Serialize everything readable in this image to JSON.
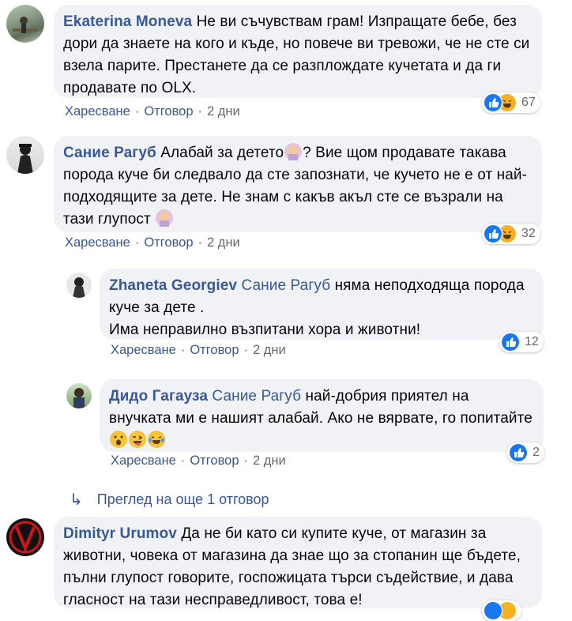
{
  "comments": [
    {
      "author": "Ekaterina Moneva",
      "text": "Не ви съчувствам грам! Изпращате бебе, без дори да знаете на кого и къде, но повече ви тревожи, че не сте си взела парите. Престанете да се разплождате кучетата и да ги продавате по OLX.",
      "like": "Харесване",
      "reply": "Отговор",
      "time": "2 дни",
      "reactions": "67"
    },
    {
      "author": "Сание Рагуб",
      "text_a": "Алабай за детето",
      "text_b": "? Вие щом продавате такава порода куче би следвало да сте запознати, че кучето не е от най-подходящите за дете. Не знам с какъв акъл сте се възрали на тази глупост",
      "like": "Харесване",
      "reply": "Отговор",
      "time": "2 дни",
      "reactions": "32"
    },
    {
      "author": "Zhaneta Georgiev",
      "mention": "Сание Рагуб",
      "text": "няма неподходяща порода куче за дете .\nИма неправилно възпитани хора и животни!",
      "like": "Харесване",
      "reply": "Отговор",
      "time": "2 дни",
      "reactions": "12"
    },
    {
      "author": "Дидо Гагауза",
      "mention": "Сание Рагуб",
      "text": "най-добрия приятел на внучката ми е нашият алабай. Ако не вярвате, го попитайте",
      "like": "Харесване",
      "reply": "Отговор",
      "time": "2 дни",
      "reactions": "2"
    },
    {
      "author": "Dimityr Urumov",
      "text": "Да не би като си купите куче, от магазин за животни, човека от магазина да знае що за стопанин ще бъдете, пълни глупост говорите, госпожицата търси съдействие, и дава гласност на тази несправедливост, това е!"
    }
  ],
  "more_replies": "Преглед на още 1 отговор",
  "colors": {
    "link": "#385898",
    "bubble": "#f0f2f5",
    "like": "#1877f2",
    "haha": "#f7b125"
  }
}
